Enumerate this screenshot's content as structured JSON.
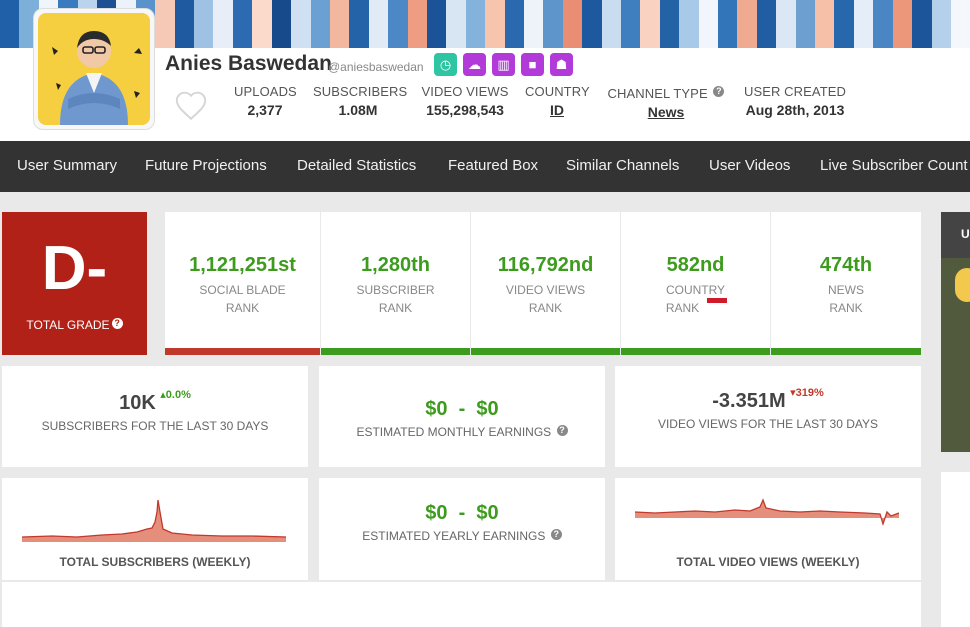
{
  "banner": {
    "stripe_colors": [
      "#2060a8",
      "#7db0d8",
      "#f0f4fb",
      "#3a7bc0",
      "#b9d4ec",
      "#1d4f92",
      "#ecf2fa",
      "#5a93cc",
      "#f5c9b5",
      "#1f5aa0",
      "#9fc2e4",
      "#e8eef8",
      "#2c6bb2",
      "#fbd9cb",
      "#174a8a",
      "#cfe0f2",
      "#6aa0d2",
      "#f3b7a0",
      "#2563a8",
      "#e1ebf6",
      "#4c88c5",
      "#ee9d82",
      "#1b5398",
      "#d8e6f4",
      "#83b2dc",
      "#f7c4ad",
      "#2a69ae",
      "#eef3fa",
      "#5e95ca",
      "#e98e72",
      "#1e589e",
      "#c9dcf0",
      "#3f7fbf",
      "#f9d2c2",
      "#2462a6",
      "#a9c9e8",
      "#f2f5fb",
      "#3275b8",
      "#f0aa90",
      "#215da2",
      "#dbe7f5",
      "#6d9fd0",
      "#f6bfa8",
      "#2767ab",
      "#e5eef8",
      "#4a86c3",
      "#ec967a",
      "#1c5599",
      "#b4d0eb",
      "#f4f7fc"
    ]
  },
  "channel": {
    "name": "Anies Baswedan",
    "handle": "@aniesbaswedan",
    "avatar_alt": "Channel avatar illustration"
  },
  "icons": [
    {
      "name": "clock-icon",
      "color": "#2ec5a3",
      "glyph": "◷"
    },
    {
      "name": "cloud-upload-icon",
      "color": "#b23ad8",
      "glyph": "☁"
    },
    {
      "name": "stats-icon",
      "color": "#b23ad8",
      "glyph": "▥"
    },
    {
      "name": "video-camera-icon",
      "color": "#b23ad8",
      "glyph": "■"
    },
    {
      "name": "users-icon",
      "color": "#b23ad8",
      "glyph": "☗"
    }
  ],
  "stats": {
    "uploads_label": "UPLOADS",
    "uploads": "2,377",
    "subscribers_label": "SUBSCRIBERS",
    "subscribers": "1.08M",
    "views_label": "VIDEO VIEWS",
    "views": "155,298,543",
    "country_label": "COUNTRY",
    "country": "ID",
    "type_label": "CHANNEL TYPE",
    "type": "News",
    "created_label": "USER CREATED",
    "created": "Aug 28th, 2013"
  },
  "nav": [
    "User Summary",
    "Future Projections",
    "Detailed Statistics",
    "Featured Box",
    "Similar Channels",
    "User Videos",
    "Live Subscriber Count"
  ],
  "grade": {
    "value": "D-",
    "label": "TOTAL GRADE"
  },
  "ranks": [
    {
      "value": "1,121,251st",
      "line1": "SOCIAL BLADE",
      "line2": "RANK",
      "bar": "#c0392b"
    },
    {
      "value": "1,280th",
      "line1": "SUBSCRIBER",
      "line2": "RANK",
      "bar": "#3d9b1e"
    },
    {
      "value": "116,792nd",
      "line1": "VIDEO VIEWS",
      "line2": "RANK",
      "bar": "#3d9b1e"
    },
    {
      "value": "582nd",
      "line1": "COUNTRY",
      "line2": "RANK",
      "bar": "#3d9b1e"
    },
    {
      "value": "474th",
      "line1": "NEWS",
      "line2": "RANK",
      "bar": "#3d9b1e"
    }
  ],
  "metrics": {
    "subs30": {
      "value": "10K",
      "change": "0.0%",
      "label": "SUBSCRIBERS FOR THE LAST 30 DAYS"
    },
    "monthly": {
      "value": "$0  -  $0",
      "label": "ESTIMATED MONTHLY EARNINGS"
    },
    "views30": {
      "value": "-3.351M",
      "change": "319%",
      "label": "VIDEO VIEWS FOR THE LAST 30 DAYS"
    },
    "yearly": {
      "value": "$0  -  $0",
      "label": "ESTIMATED YEARLY EARNINGS"
    },
    "subs_weekly_label": "TOTAL SUBSCRIBERS (WEEKLY)",
    "views_weekly_label": "TOTAL VIDEO VIEWS (WEEKLY)"
  },
  "sidebar": {
    "label": "U"
  },
  "colors": {
    "accent_green": "#3d9b1e",
    "accent_red": "#b22117",
    "nav_bg": "#333333",
    "spark_fill": "#d9654f"
  }
}
